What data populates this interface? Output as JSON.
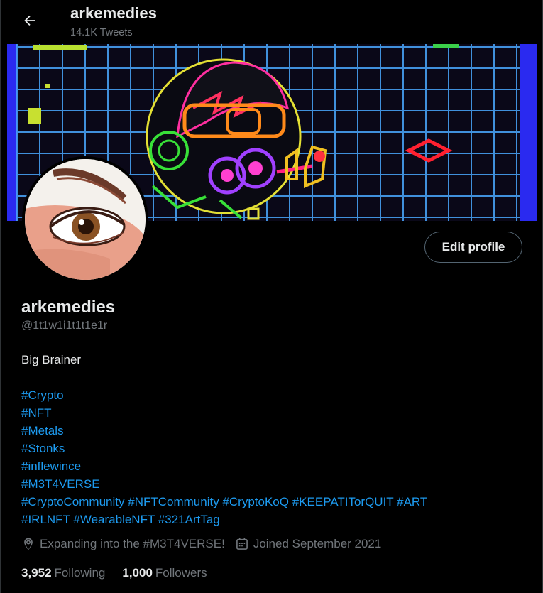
{
  "header": {
    "name": "arkemedies",
    "tweet_count": "14.1K Tweets"
  },
  "profile": {
    "display_name": "arkemedies",
    "handle": "@1t1w1i1t1t1e1r",
    "edit_label": "Edit profile",
    "bio_line": "Big Brainer",
    "hashtag_lines": [
      [
        "#Crypto"
      ],
      [
        "#NFT"
      ],
      [
        "#Metals"
      ],
      [
        "#Stonks"
      ],
      [
        "#inflewince"
      ],
      [
        "#M3T4VERSE"
      ],
      [
        "#CryptoCommunity",
        "#NFTCommunity",
        "#CryptoKoQ",
        "#KEEPATITorQUIT",
        "#ART"
      ],
      [
        "#IRLNFT",
        "#WearableNFT",
        "#321ArtTag"
      ]
    ],
    "location": "Expanding into the #M3T4VERSE!",
    "joined": "Joined September 2021",
    "following_count": "3,952",
    "following_label": "Following",
    "followers_count": "1,000",
    "followers_label": "Followers"
  },
  "icons": {
    "back": "arrow-left-icon",
    "location": "location-pin-icon",
    "calendar": "calendar-icon"
  },
  "colors": {
    "background": "#000000",
    "text_primary": "#e7e9ea",
    "text_secondary": "#71767b",
    "accent": "#1d9bf0",
    "border": "#536471"
  }
}
